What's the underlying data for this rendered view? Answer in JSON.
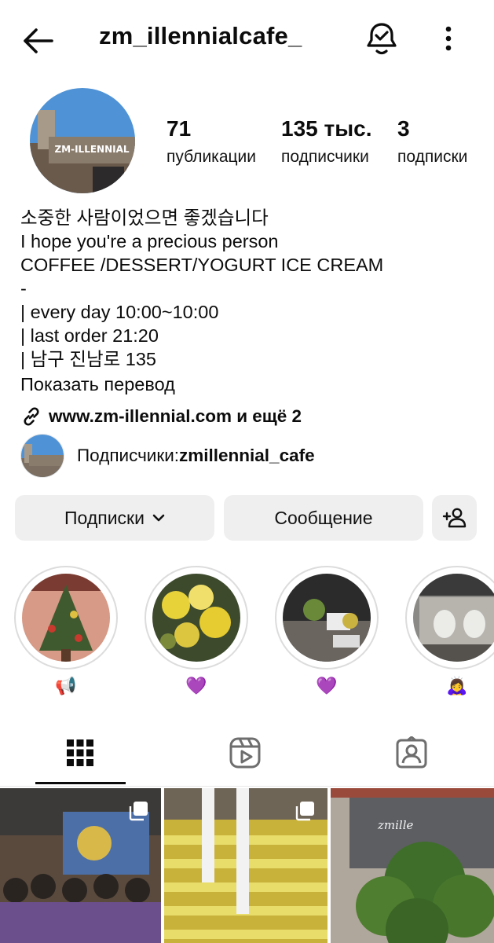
{
  "header": {
    "username": "zm_illennialcafe_",
    "back_icon": "arrow-left-icon",
    "bell_icon": "bell-check-icon",
    "more_icon": "more-vertical-icon"
  },
  "profile": {
    "avatar_sign_text": "ZM-ILLENNIAL",
    "stats": [
      {
        "num": "71",
        "label": "публикации"
      },
      {
        "num": "135 тыс.",
        "label": "подписчики"
      },
      {
        "num": "3",
        "label": "подписки"
      }
    ]
  },
  "bio": {
    "lines": [
      "소중한 사람이었으면 좋겠습니다",
      "I hope you're a precious person",
      "COFFEE /DESSERT/YOGURT ICE CREAM",
      "-",
      "| every day 10:00~10:00",
      "| last order 21:20",
      "| 남구 진남로 135"
    ],
    "translate": "Показать перевод",
    "link": "www.zm-illennial.com и ещё 2",
    "followed_prefix": "Подписчики: ",
    "followed_name": "zmillennial_cafe"
  },
  "actions": {
    "follow": "Подписки",
    "message": "Сообщение",
    "add_user_icon": "add-user-icon"
  },
  "highlights": [
    {
      "emoji": "📢",
      "icon": "megaphone"
    },
    {
      "emoji": "💜",
      "icon": "purple-heart"
    },
    {
      "emoji": "💜",
      "icon": "purple-heart"
    },
    {
      "emoji": "🙇‍♀️",
      "icon": "bowing-woman"
    }
  ],
  "tabs": [
    {
      "icon": "grid-icon",
      "active": true
    },
    {
      "icon": "reels-icon",
      "active": false
    },
    {
      "icon": "tagged-icon",
      "active": false
    }
  ],
  "posts": [
    {
      "sign_text": "",
      "multi": true
    },
    {
      "sign_text": "",
      "multi": true
    },
    {
      "sign_text": "zmille",
      "multi": false
    }
  ],
  "colors": {
    "button_bg": "#efefef",
    "text": "#0c0c0c",
    "highlight_ring": "#dcdcdc"
  }
}
